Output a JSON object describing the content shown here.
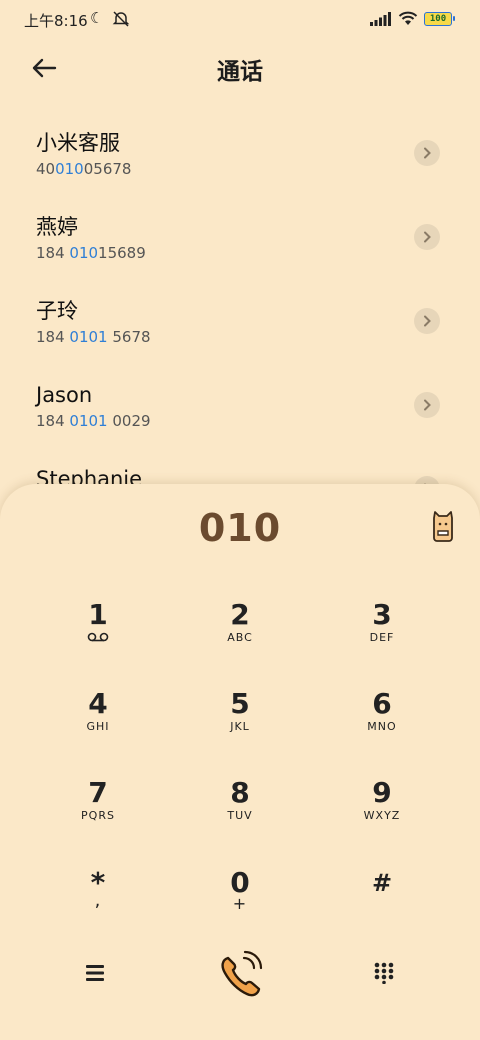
{
  "status": {
    "time": "上午8:16",
    "battery": "100"
  },
  "header": {
    "title": "通话"
  },
  "contacts": [
    {
      "name": "小米客服",
      "num_pre": "40",
      "num_hl": "010",
      "num_post": "05678"
    },
    {
      "name": "燕婷",
      "num_pre": "184 ",
      "num_hl": "010",
      "num_post": "15689"
    },
    {
      "name": "子玲",
      "num_pre": "184 ",
      "num_hl": "0101",
      "num_post": " 5678"
    },
    {
      "name": "Jason",
      "num_pre": "184 ",
      "num_hl": "0101",
      "num_post": " 0029"
    },
    {
      "name": "Stephanie",
      "num_pre": "",
      "num_hl": "",
      "num_post": ""
    }
  ],
  "dialer": {
    "input": "010",
    "keys": [
      {
        "digit": "1",
        "letters": ""
      },
      {
        "digit": "2",
        "letters": "ABC"
      },
      {
        "digit": "3",
        "letters": "DEF"
      },
      {
        "digit": "4",
        "letters": "GHI"
      },
      {
        "digit": "5",
        "letters": "JKL"
      },
      {
        "digit": "6",
        "letters": "MNO"
      },
      {
        "digit": "7",
        "letters": "PQRS"
      },
      {
        "digit": "8",
        "letters": "TUV"
      },
      {
        "digit": "9",
        "letters": "WXYZ"
      },
      {
        "digit": "*",
        "letters": ","
      },
      {
        "digit": "0",
        "letters": "+"
      },
      {
        "digit": "#",
        "letters": ""
      }
    ]
  },
  "icons": {
    "back": "back-arrow-icon",
    "chevron": "chevron-right-icon",
    "menu": "menu-icon",
    "call": "phone-call-icon",
    "keypad": "keypad-icon",
    "voicemail": "voicemail-icon"
  },
  "colors": {
    "background": "#FBE8C8",
    "highlight": "#2f7fd6",
    "dialed": "#6b4b2f",
    "accent": "#F0A24A"
  }
}
